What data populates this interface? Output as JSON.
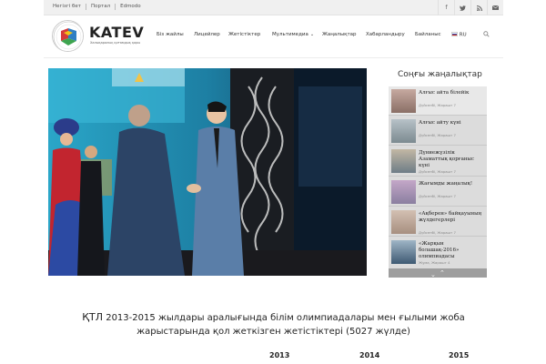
{
  "topbar": {
    "links": [
      "Негізгі бет",
      "Портал",
      "Edmodo"
    ],
    "social_icons": [
      "facebook-icon",
      "twitter-icon",
      "rss-icon",
      "mail-icon"
    ]
  },
  "brand": {
    "name": "KATEV",
    "subtitle": "Халықаралық қоғамдық қоры"
  },
  "nav": {
    "items": [
      "Біз жайлы",
      "Лицейлер",
      "Жетістіктер",
      "Мультимедиа",
      "Жаңалықтар",
      "Хабарландыру",
      "Байланыс"
    ],
    "lang": "RU",
    "search_icon": "search-icon"
  },
  "news": {
    "title": "Соңғы жаңалықтар",
    "items": [
      {
        "headline": "Алғыс айта білейік",
        "meta": "Дүйсенбі, Жарашт 7"
      },
      {
        "headline": "Алғыс айту күні",
        "meta": "Дүйсенбі, Жарашт 7"
      },
      {
        "headline": "Дүниежүзілік Азаматтық қорғаныс күні",
        "meta": "Дүйсенбі, Жарашт 7"
      },
      {
        "headline": "Жағымды жаңалық!",
        "meta": "Дүйсенбі, Жарашт 7"
      },
      {
        "headline": "«Ақберен» байқауының жүлдегерлері",
        "meta": "Дүйсенбі, Жарашт 7"
      },
      {
        "headline": "«Жарқын болашақ-2016» олимпиадасы",
        "meta": "Жұма, Жарашт 4"
      }
    ],
    "nav_up": "⌃",
    "nav_down": "⌃"
  },
  "achievements": {
    "title_part1": "ҚТЛ",
    "title_part2": "2013-2015 жылдары аралығында білім олимпиадалары мен ғылыми жоба",
    "title_line2": "жарыстарында қол жеткізген жетістіктері (5027 жүлде)",
    "years": [
      "2013",
      "2014",
      "2015"
    ]
  },
  "colors": {
    "topbar_bg": "#f0f0f0",
    "sidebar_bg": "#dcdcdc",
    "sidebar_nav": "#9e9e9e"
  }
}
